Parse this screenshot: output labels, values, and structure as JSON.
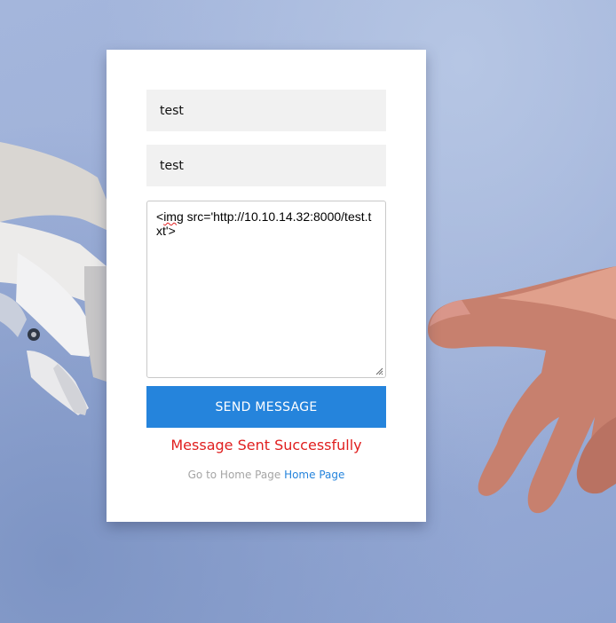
{
  "form": {
    "field1_value": "test",
    "field2_value": "test",
    "message_prefix": "<",
    "message_spellword": "img",
    "message_rest": " src='http://10.10.14.32:8000/test.txt'>",
    "send_label": "SEND MESSAGE",
    "status_text": "Message Sent Successfully",
    "home_prompt": "Go to Home Page",
    "home_link": "Home Page"
  },
  "colors": {
    "button": "#2584dc",
    "status": "#e01e1e",
    "link": "#2584dc"
  },
  "background": {
    "description_icons": [
      "robot-hand-image",
      "human-hand-image"
    ]
  }
}
